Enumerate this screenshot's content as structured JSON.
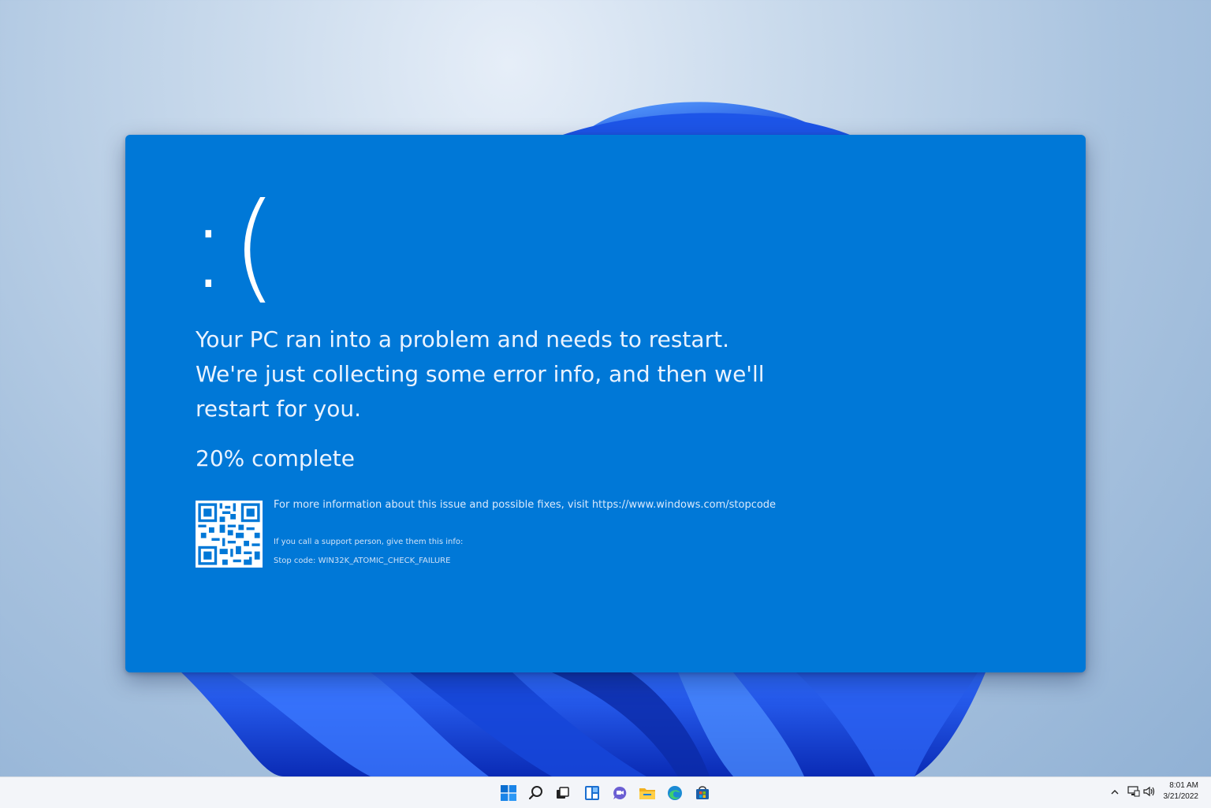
{
  "bsod": {
    "face": ":(",
    "message": "Your PC ran into a problem and needs to restart. We're just collecting some error info, and then we'll restart for you.",
    "progress_text": "20% complete",
    "progress_percent": 20,
    "info_text": "For more information about this issue and possible fixes, visit https://www.windows.com/stopcode",
    "support_text": "If you call a support person, give them this info:",
    "stop_code_text": "Stop code: WIN32K_ATOMIC_CHECK_FAILURE",
    "background_color": "#0078d7"
  },
  "taskbar": {
    "icons": [
      "windows-start-icon",
      "search-icon",
      "task-view-icon",
      "widgets-icon",
      "teams-chat-icon",
      "file-explorer-icon",
      "edge-browser-icon",
      "microsoft-store-icon"
    ],
    "tray_icons": [
      "chevron-up-icon",
      "network-icon",
      "volume-icon"
    ],
    "time": "8:01 AM",
    "date": "3/21/2022"
  }
}
